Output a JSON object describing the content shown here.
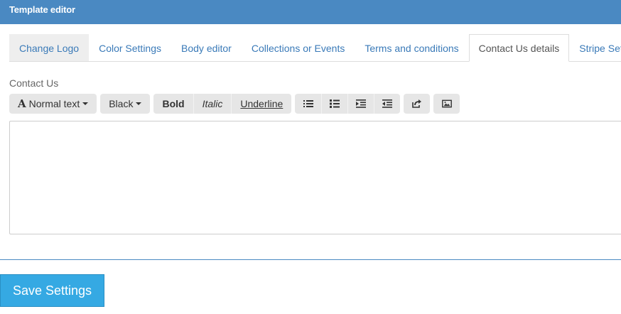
{
  "header": {
    "title": "Template editor"
  },
  "tabs": [
    {
      "label": "Change Logo"
    },
    {
      "label": "Color Settings"
    },
    {
      "label": "Body editor"
    },
    {
      "label": "Collections or Events"
    },
    {
      "label": "Terms and conditions"
    },
    {
      "label": "Contact Us details",
      "active": true
    },
    {
      "label": "Stripe Settings"
    }
  ],
  "section": {
    "label": "Contact Us"
  },
  "toolbar": {
    "font_style": "Normal text",
    "font_color": "Black",
    "bold": "Bold",
    "italic": "Italic",
    "underline": "Underline",
    "icons": [
      "unordered-list-icon",
      "ordered-list-icon",
      "indent-icon",
      "outdent-icon",
      "link-icon",
      "image-icon"
    ]
  },
  "editor": {
    "content": ""
  },
  "save_button": {
    "label": "Save Settings"
  },
  "colors": {
    "header": "#4a89c2",
    "accent": "#35a9e3",
    "tab_link": "#3a7ab8"
  }
}
